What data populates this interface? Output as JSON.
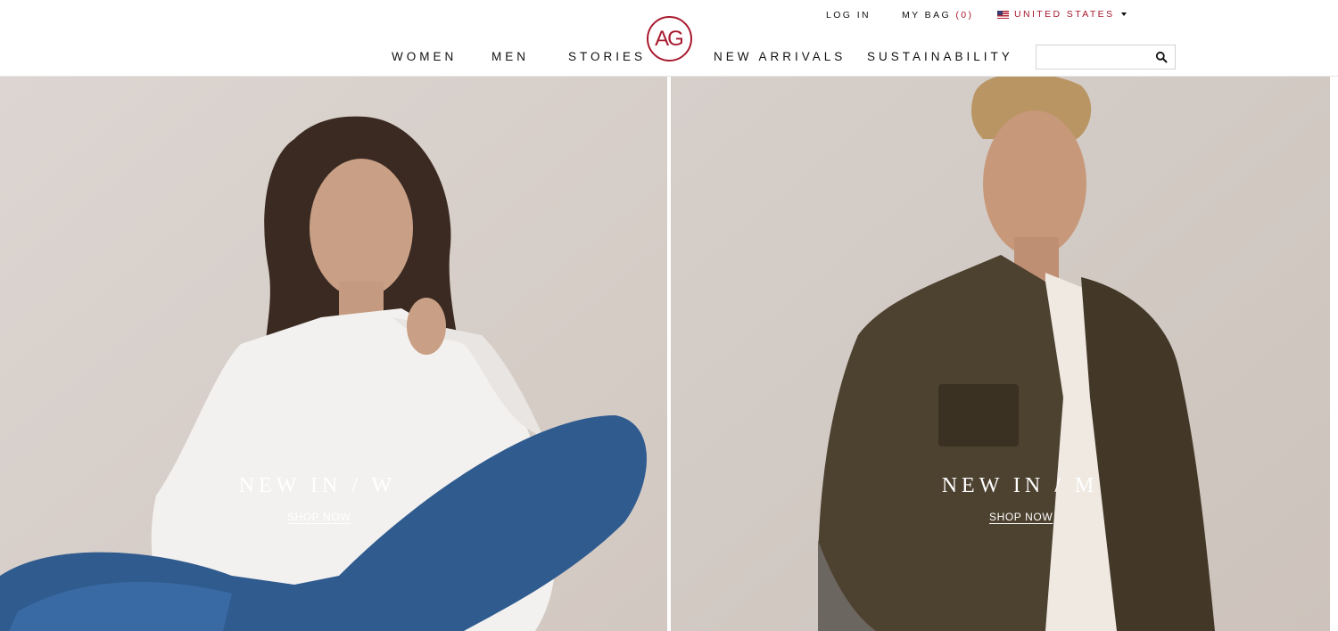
{
  "utility": {
    "login": "LOG IN",
    "bag_label": "MY BAG",
    "bag_count": "(0)",
    "country": "UNITED STATES"
  },
  "logo": {
    "text": "AG"
  },
  "nav": {
    "women": "WOMEN",
    "men": "MEN",
    "stories": "STORIES",
    "new_arrivals": "NEW ARRIVALS",
    "sustainability": "SUSTAINABILITY"
  },
  "search": {
    "placeholder": "",
    "value": "",
    "icon": "search-icon"
  },
  "hero": {
    "left": {
      "title": "NEW IN / W",
      "link": "SHOP NOW"
    },
    "right": {
      "title": "NEW IN / M",
      "link": "SHOP NOW"
    }
  },
  "colors": {
    "brand_red": "#a8192e",
    "background_left": "#d9d1cc",
    "background_right": "#d3cbc5"
  }
}
